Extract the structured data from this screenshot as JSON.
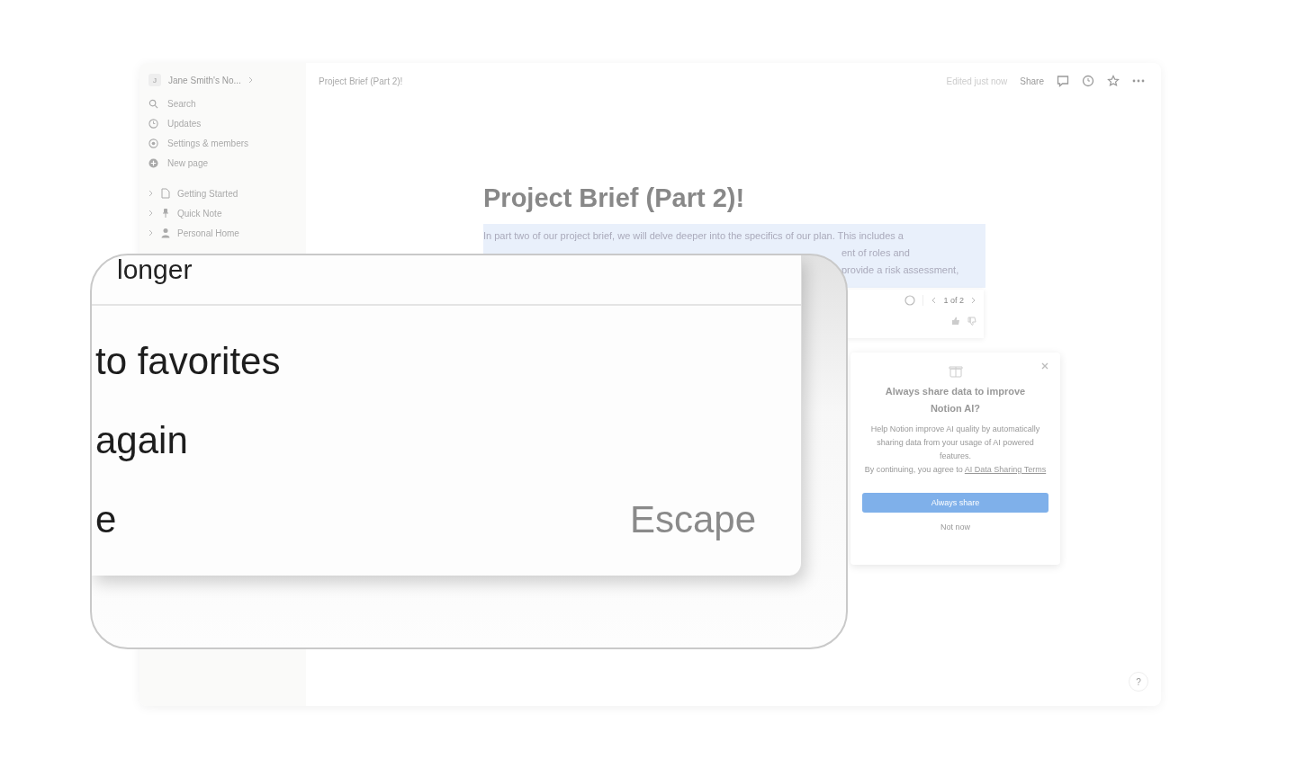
{
  "sidebar": {
    "workspace": {
      "avatar": "J",
      "name": "Jane Smith's No..."
    },
    "items": [
      {
        "kind": "search",
        "label": "Search"
      },
      {
        "kind": "updates",
        "label": "Updates"
      },
      {
        "kind": "settings",
        "label": "Settings & members"
      },
      {
        "kind": "new",
        "label": "New page"
      }
    ],
    "pages": [
      {
        "kind": "doc",
        "label": "Getting Started",
        "expanded": false
      },
      {
        "kind": "pin",
        "label": "Quick Note",
        "expanded": false
      },
      {
        "kind": "person",
        "label": "Personal Home",
        "expanded": false
      }
    ]
  },
  "topbar": {
    "breadcrumb": "Project Brief (Part 2)!",
    "edited": "Edited just now",
    "share": "Share"
  },
  "page": {
    "title": "Project Brief (Part 2)!",
    "paragraph_lines": [
      "In part two of our project brief, we will delve deeper into the specifics of our plan. This includes a",
      "ent of roles and",
      "provide a risk assessment,"
    ]
  },
  "ai_toolbar": {
    "counter": "1 of 2"
  },
  "dialog": {
    "title": "Always share data to improve Notion AI?",
    "body": "Help Notion improve AI quality by automatically sharing data from your usage of AI powered features.",
    "terms": "By continuing, you agree to",
    "terms_link": "AI Data Sharing Terms",
    "primary": "Always share",
    "secondary": "Not now"
  },
  "help": "?",
  "zoom_menu": {
    "top_cut": "longer",
    "items": [
      {
        "label": "to favorites"
      },
      {
        "label": "again"
      },
      {
        "label": "e",
        "shortcut": "Escape"
      }
    ]
  }
}
